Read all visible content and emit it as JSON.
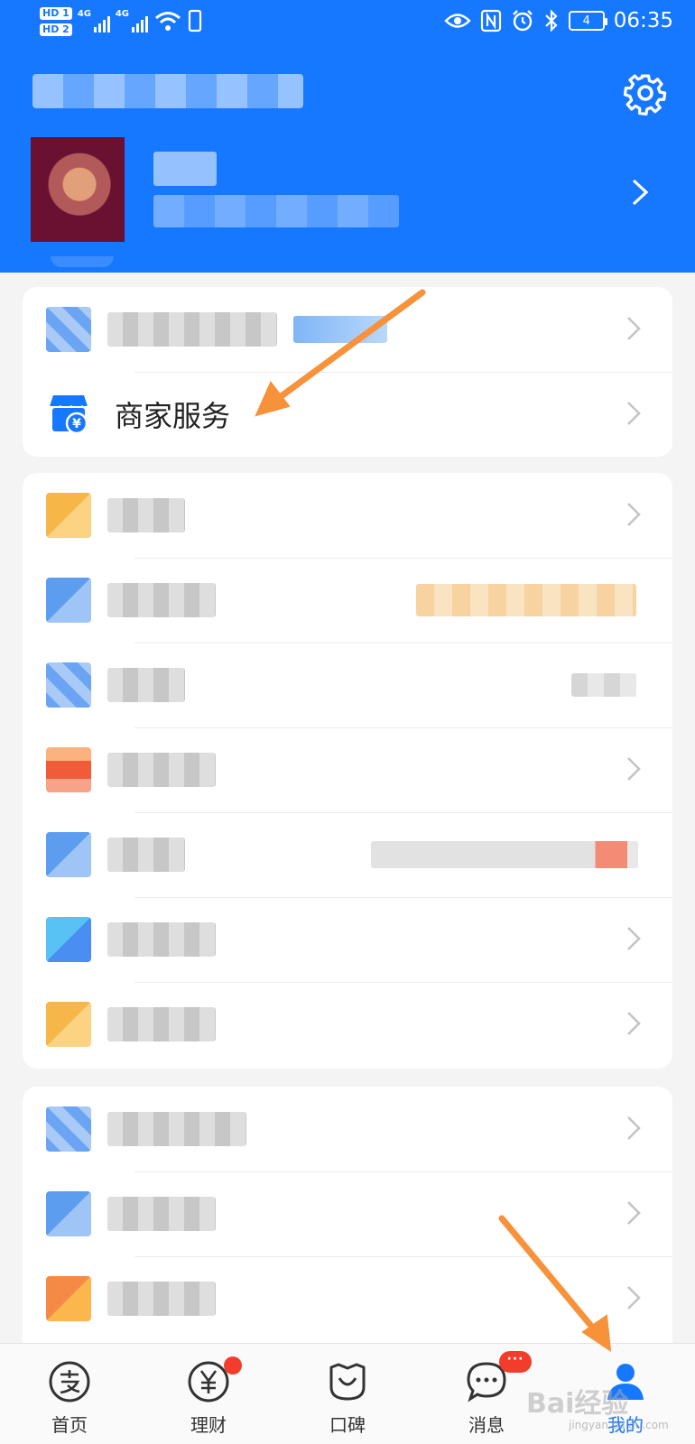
{
  "status_bar": {
    "hd1": "HD 1",
    "hd2": "HD 2",
    "net1": "4G",
    "net2": "4G",
    "battery": "4",
    "time": "06:35"
  },
  "header": {
    "settings_icon": "gear-icon",
    "chevron_icon": "chevron-right-icon"
  },
  "menu": {
    "merchant_service_label": "商家服务"
  },
  "tabbar": {
    "items": [
      {
        "label": "首页",
        "icon": "alipay-icon"
      },
      {
        "label": "理财",
        "icon": "yuan-icon",
        "badge": "dot"
      },
      {
        "label": "口碑",
        "icon": "koubei-icon"
      },
      {
        "label": "消息",
        "icon": "chat-bubble-icon",
        "badge": "···"
      },
      {
        "label": "我的",
        "icon": "person-icon",
        "active": true
      }
    ]
  },
  "watermark": {
    "brand": "Bai经验",
    "url": "jingyan.baidu.com"
  },
  "colors": {
    "primary": "#1677ff",
    "badge": "#f33c2b",
    "annotation_arrow": "#f7913a"
  }
}
